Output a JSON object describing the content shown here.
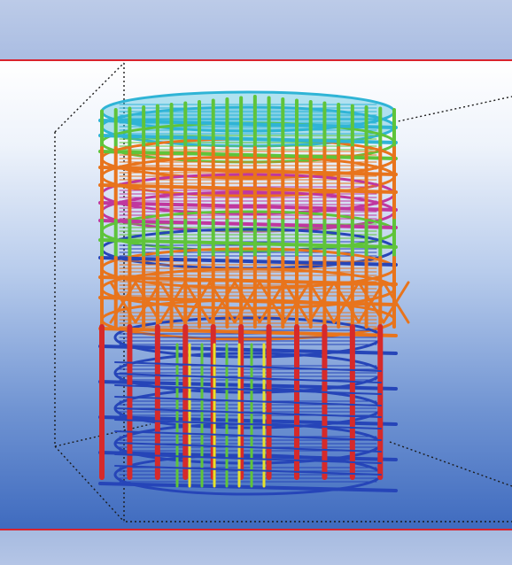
{
  "colors": {
    "frame_red": "#d9232d",
    "roof_cyan": "#2fb4d6",
    "green": "#5fc43a",
    "orange": "#e8741c",
    "magenta": "#c0379f",
    "red": "#d62a2a",
    "blue": "#2645b8",
    "yellow": "#e6e12a",
    "bbox_dotted": "#222222"
  },
  "icons": {
    "model": "structural-steel-model-icon"
  }
}
